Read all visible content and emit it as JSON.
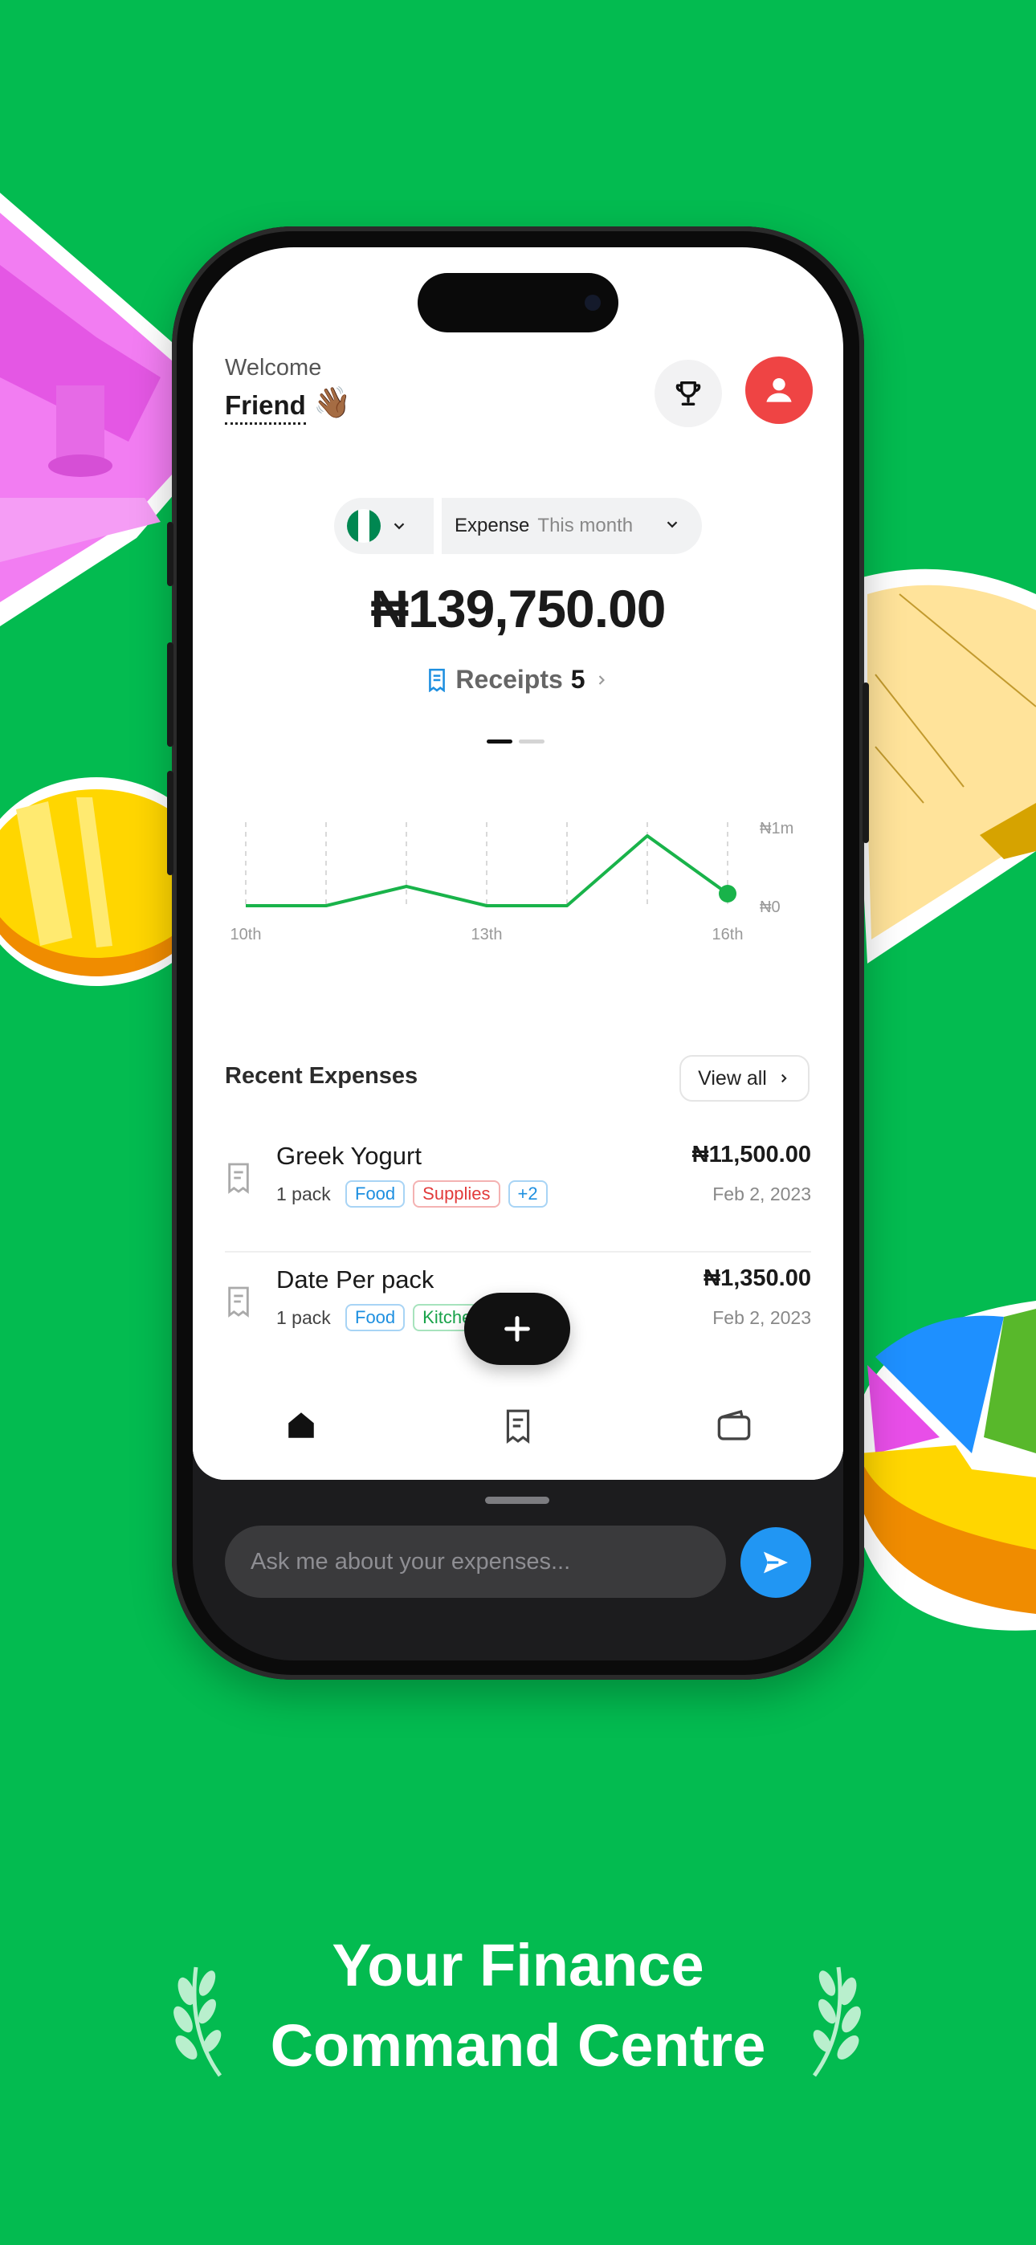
{
  "colors": {
    "background": "#03BB50",
    "accent_green": "#19b34a",
    "avatar_red": "#ef4444",
    "send_blue": "#2196f3"
  },
  "header": {
    "welcome": "Welcome",
    "name": "Friend",
    "wave_emoji": "👋🏾",
    "trophy_icon": "trophy-icon",
    "avatar_icon": "user-icon"
  },
  "filters": {
    "country_flag": "Nigeria",
    "type_label": "Expense",
    "period_label": "This month"
  },
  "summary": {
    "amount": "₦139,750.00",
    "receipts_label": "Receipts",
    "receipts_count": "5"
  },
  "chart_data": {
    "type": "line",
    "x": [
      "10th",
      "11th",
      "12th",
      "13th",
      "14th",
      "15th",
      "16th"
    ],
    "x_tick_labels": [
      "10th",
      "13th",
      "16th"
    ],
    "y_tick_labels": [
      "₦1m",
      "₦0"
    ],
    "series": [
      {
        "values": [
          0,
          0,
          240000,
          0,
          0,
          870000,
          150000
        ]
      }
    ],
    "ylim": [
      0,
      1000000
    ],
    "grid": "vertical dashed"
  },
  "recent": {
    "title": "Recent Expenses",
    "view_all": "View all",
    "items": [
      {
        "name": "Greek Yogurt",
        "qty": "1 pack",
        "tags": [
          "Food",
          "Supplies",
          "+2"
        ],
        "amount": "₦11,500.00",
        "date": "Feb 2, 2023"
      },
      {
        "name": "Date Per pack",
        "qty": "1 pack",
        "tags": [
          "Food",
          "Kitchen"
        ],
        "amount": "₦1,350.00",
        "date": "Feb 2, 2023"
      }
    ]
  },
  "nav": {
    "items": [
      "home-icon",
      "receipt-icon",
      "wallet-icon"
    ]
  },
  "chat": {
    "placeholder": "Ask me about your expenses..."
  },
  "headline": {
    "line1": "Your Finance",
    "line2": "Command Centre"
  }
}
